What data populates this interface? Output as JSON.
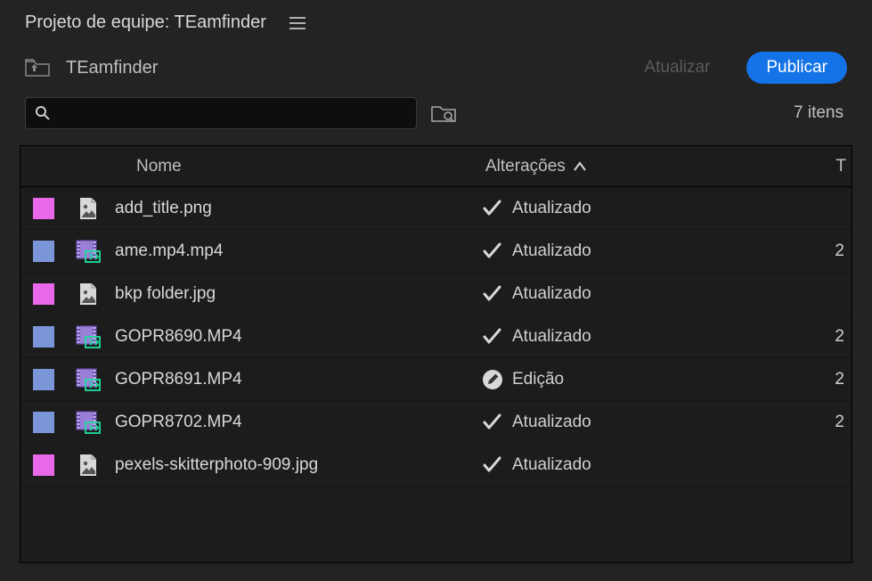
{
  "header": {
    "title": "Projeto de equipe: TEamfinder"
  },
  "toolbar": {
    "project_name": "TEamfinder",
    "update_label": "Atualizar",
    "publish_label": "Publicar"
  },
  "search": {
    "placeholder": ""
  },
  "item_count": "7 itens",
  "columns": {
    "name": "Nome",
    "changes": "Alterações",
    "last": "T"
  },
  "status_labels": {
    "updated": "Atualizado",
    "editing": "Edição"
  },
  "colors": {
    "pink": "#e868e8",
    "blue": "#7a96d8",
    "accent": "#1473e6"
  },
  "items": [
    {
      "label": "pink",
      "type": "image",
      "name": "add_title.png",
      "status": "updated",
      "extra": ""
    },
    {
      "label": "blue",
      "type": "video",
      "name": "ame.mp4.mp4",
      "status": "updated",
      "extra": "2"
    },
    {
      "label": "pink",
      "type": "image",
      "name": "bkp folder.jpg",
      "status": "updated",
      "extra": ""
    },
    {
      "label": "blue",
      "type": "video",
      "name": "GOPR8690.MP4",
      "status": "updated",
      "extra": "2"
    },
    {
      "label": "blue",
      "type": "video",
      "name": "GOPR8691.MP4",
      "status": "editing",
      "extra": "2"
    },
    {
      "label": "blue",
      "type": "video",
      "name": "GOPR8702.MP4",
      "status": "updated",
      "extra": "2"
    },
    {
      "label": "pink",
      "type": "image",
      "name": "pexels-skitterphoto-909.jpg",
      "status": "updated",
      "extra": ""
    }
  ]
}
